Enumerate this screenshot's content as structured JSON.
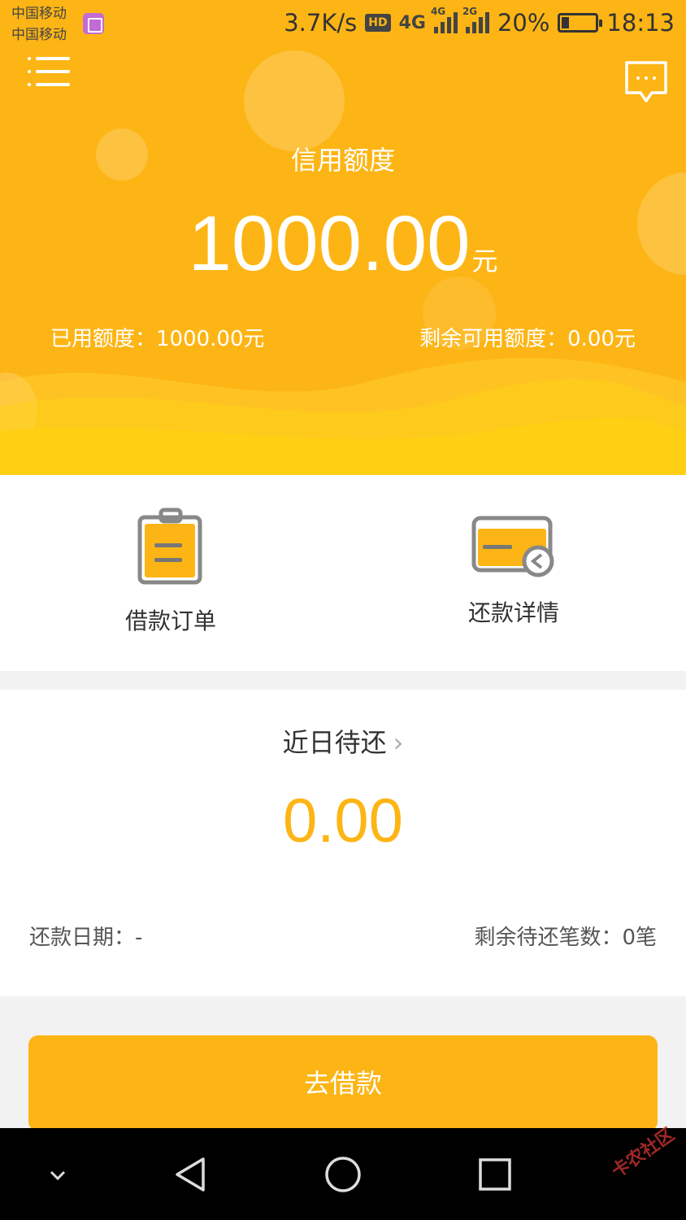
{
  "status_bar": {
    "carrier_1": "中国移动",
    "carrier_2": "中国移动",
    "speed": "3.7K/s",
    "hd": "HD",
    "network_1": "4G",
    "network_2_tag": "4G",
    "network_3_tag": "2G",
    "battery": "20%",
    "battery_level": 0.2,
    "time": "18:13"
  },
  "header": {
    "credit_label": "信用额度",
    "credit_amount": "1000.00",
    "credit_unit": "元",
    "used_credit": "已用额度：1000.00元",
    "remaining_credit": "剩余可用额度：0.00元"
  },
  "actions": {
    "loan_orders": "借款订单",
    "repayment_details": "还款详情"
  },
  "repayment": {
    "title": "近日待还",
    "chevron": "›",
    "amount": "0.00",
    "date": "还款日期：-",
    "remaining_count": "剩余待还笔数：0笔"
  },
  "cta": {
    "label": "去借款"
  },
  "icons": {
    "menu": "menu-icon",
    "message": "message-icon",
    "orders": "clipboard-icon",
    "repay": "card-icon",
    "nav_down": "chevron-down-icon",
    "nav_back": "back-triangle-icon",
    "nav_home": "home-circle-icon",
    "nav_recent": "recent-square-icon"
  },
  "colors": {
    "brand": "#fdb515",
    "text": "#333333"
  },
  "watermark": "卡农社区"
}
